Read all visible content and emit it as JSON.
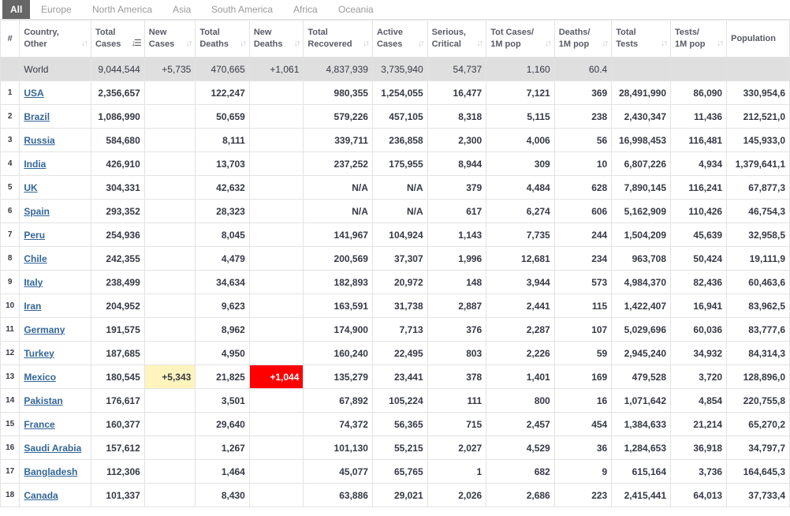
{
  "tabs": [
    "All",
    "Europe",
    "North America",
    "Asia",
    "South America",
    "Africa",
    "Oceania"
  ],
  "headers": {
    "index": "#",
    "country": "Country, Other",
    "total_cases": "Total Cases",
    "new_cases": "New Cases",
    "total_deaths": "Total Deaths",
    "new_deaths": "New Deaths",
    "total_recovered": "Total Recovered",
    "active_cases": "Active Cases",
    "serious": "Serious, Critical",
    "tot_cases_1m": "Tot Cases/ 1M pop",
    "deaths_1m": "Deaths/ 1M pop",
    "total_tests": "Total Tests",
    "tests_1m": "Tests/ 1M pop",
    "population": "Population"
  },
  "world": {
    "country": "World",
    "total_cases": "9,044,544",
    "new_cases": "+5,735",
    "total_deaths": "470,665",
    "new_deaths": "+1,061",
    "total_recovered": "4,837,939",
    "active_cases": "3,735,940",
    "serious": "54,737",
    "tot_cases_1m": "1,160",
    "deaths_1m": "60.4",
    "total_tests": "",
    "tests_1m": "",
    "population": ""
  },
  "rows": [
    {
      "idx": "1",
      "country": "USA",
      "total_cases": "2,356,657",
      "new_cases": "",
      "total_deaths": "122,247",
      "new_deaths": "",
      "total_recovered": "980,355",
      "active_cases": "1,254,055",
      "serious": "16,477",
      "tot_cases_1m": "7,121",
      "deaths_1m": "369",
      "total_tests": "28,491,990",
      "tests_1m": "86,090",
      "population": "330,954,6"
    },
    {
      "idx": "2",
      "country": "Brazil",
      "total_cases": "1,086,990",
      "new_cases": "",
      "total_deaths": "50,659",
      "new_deaths": "",
      "total_recovered": "579,226",
      "active_cases": "457,105",
      "serious": "8,318",
      "tot_cases_1m": "5,115",
      "deaths_1m": "238",
      "total_tests": "2,430,347",
      "tests_1m": "11,436",
      "population": "212,521,0"
    },
    {
      "idx": "3",
      "country": "Russia",
      "total_cases": "584,680",
      "new_cases": "",
      "total_deaths": "8,111",
      "new_deaths": "",
      "total_recovered": "339,711",
      "active_cases": "236,858",
      "serious": "2,300",
      "tot_cases_1m": "4,006",
      "deaths_1m": "56",
      "total_tests": "16,998,453",
      "tests_1m": "116,481",
      "population": "145,933,0"
    },
    {
      "idx": "4",
      "country": "India",
      "total_cases": "426,910",
      "new_cases": "",
      "total_deaths": "13,703",
      "new_deaths": "",
      "total_recovered": "237,252",
      "active_cases": "175,955",
      "serious": "8,944",
      "tot_cases_1m": "309",
      "deaths_1m": "10",
      "total_tests": "6,807,226",
      "tests_1m": "4,934",
      "population": "1,379,641,1"
    },
    {
      "idx": "5",
      "country": "UK",
      "total_cases": "304,331",
      "new_cases": "",
      "total_deaths": "42,632",
      "new_deaths": "",
      "total_recovered": "N/A",
      "active_cases": "N/A",
      "serious": "379",
      "tot_cases_1m": "4,484",
      "deaths_1m": "628",
      "total_tests": "7,890,145",
      "tests_1m": "116,241",
      "population": "67,877,3"
    },
    {
      "idx": "6",
      "country": "Spain",
      "total_cases": "293,352",
      "new_cases": "",
      "total_deaths": "28,323",
      "new_deaths": "",
      "total_recovered": "N/A",
      "active_cases": "N/A",
      "serious": "617",
      "tot_cases_1m": "6,274",
      "deaths_1m": "606",
      "total_tests": "5,162,909",
      "tests_1m": "110,426",
      "population": "46,754,3"
    },
    {
      "idx": "7",
      "country": "Peru",
      "total_cases": "254,936",
      "new_cases": "",
      "total_deaths": "8,045",
      "new_deaths": "",
      "total_recovered": "141,967",
      "active_cases": "104,924",
      "serious": "1,143",
      "tot_cases_1m": "7,735",
      "deaths_1m": "244",
      "total_tests": "1,504,209",
      "tests_1m": "45,639",
      "population": "32,958,5"
    },
    {
      "idx": "8",
      "country": "Chile",
      "total_cases": "242,355",
      "new_cases": "",
      "total_deaths": "4,479",
      "new_deaths": "",
      "total_recovered": "200,569",
      "active_cases": "37,307",
      "serious": "1,996",
      "tot_cases_1m": "12,681",
      "deaths_1m": "234",
      "total_tests": "963,708",
      "tests_1m": "50,424",
      "population": "19,111,9"
    },
    {
      "idx": "9",
      "country": "Italy",
      "total_cases": "238,499",
      "new_cases": "",
      "total_deaths": "34,634",
      "new_deaths": "",
      "total_recovered": "182,893",
      "active_cases": "20,972",
      "serious": "148",
      "tot_cases_1m": "3,944",
      "deaths_1m": "573",
      "total_tests": "4,984,370",
      "tests_1m": "82,436",
      "population": "60,463,6"
    },
    {
      "idx": "10",
      "country": "Iran",
      "total_cases": "204,952",
      "new_cases": "",
      "total_deaths": "9,623",
      "new_deaths": "",
      "total_recovered": "163,591",
      "active_cases": "31,738",
      "serious": "2,887",
      "tot_cases_1m": "2,441",
      "deaths_1m": "115",
      "total_tests": "1,422,407",
      "tests_1m": "16,941",
      "population": "83,962,5"
    },
    {
      "idx": "11",
      "country": "Germany",
      "total_cases": "191,575",
      "new_cases": "",
      "total_deaths": "8,962",
      "new_deaths": "",
      "total_recovered": "174,900",
      "active_cases": "7,713",
      "serious": "376",
      "tot_cases_1m": "2,287",
      "deaths_1m": "107",
      "total_tests": "5,029,696",
      "tests_1m": "60,036",
      "population": "83,777,6"
    },
    {
      "idx": "12",
      "country": "Turkey",
      "total_cases": "187,685",
      "new_cases": "",
      "total_deaths": "4,950",
      "new_deaths": "",
      "total_recovered": "160,240",
      "active_cases": "22,495",
      "serious": "803",
      "tot_cases_1m": "2,226",
      "deaths_1m": "59",
      "total_tests": "2,945,240",
      "tests_1m": "34,932",
      "population": "84,314,3"
    },
    {
      "idx": "13",
      "country": "Mexico",
      "total_cases": "180,545",
      "new_cases": "+5,343",
      "total_deaths": "21,825",
      "new_deaths": "+1,044",
      "total_recovered": "135,279",
      "active_cases": "23,441",
      "serious": "378",
      "tot_cases_1m": "1,401",
      "deaths_1m": "169",
      "total_tests": "479,528",
      "tests_1m": "3,720",
      "population": "128,896,0"
    },
    {
      "idx": "14",
      "country": "Pakistan",
      "total_cases": "176,617",
      "new_cases": "",
      "total_deaths": "3,501",
      "new_deaths": "",
      "total_recovered": "67,892",
      "active_cases": "105,224",
      "serious": "111",
      "tot_cases_1m": "800",
      "deaths_1m": "16",
      "total_tests": "1,071,642",
      "tests_1m": "4,854",
      "population": "220,755,8"
    },
    {
      "idx": "15",
      "country": "France",
      "total_cases": "160,377",
      "new_cases": "",
      "total_deaths": "29,640",
      "new_deaths": "",
      "total_recovered": "74,372",
      "active_cases": "56,365",
      "serious": "715",
      "tot_cases_1m": "2,457",
      "deaths_1m": "454",
      "total_tests": "1,384,633",
      "tests_1m": "21,214",
      "population": "65,270,2"
    },
    {
      "idx": "16",
      "country": "Saudi Arabia",
      "total_cases": "157,612",
      "new_cases": "",
      "total_deaths": "1,267",
      "new_deaths": "",
      "total_recovered": "101,130",
      "active_cases": "55,215",
      "serious": "2,027",
      "tot_cases_1m": "4,529",
      "deaths_1m": "36",
      "total_tests": "1,284,653",
      "tests_1m": "36,918",
      "population": "34,797,7"
    },
    {
      "idx": "17",
      "country": "Bangladesh",
      "total_cases": "112,306",
      "new_cases": "",
      "total_deaths": "1,464",
      "new_deaths": "",
      "total_recovered": "45,077",
      "active_cases": "65,765",
      "serious": "1",
      "tot_cases_1m": "682",
      "deaths_1m": "9",
      "total_tests": "615,164",
      "tests_1m": "3,736",
      "population": "164,645,3"
    },
    {
      "idx": "18",
      "country": "Canada",
      "total_cases": "101,337",
      "new_cases": "",
      "total_deaths": "8,430",
      "new_deaths": "",
      "total_recovered": "63,886",
      "active_cases": "29,021",
      "serious": "2,026",
      "tot_cases_1m": "2,686",
      "deaths_1m": "223",
      "total_tests": "2,415,441",
      "tests_1m": "64,013",
      "population": "37,733,4"
    }
  ],
  "colors": {
    "tab_active_bg": "#666666",
    "link": "#336699",
    "world_row_bg": "#dfdfdf",
    "new_cases_highlight": "#fff5bc",
    "new_deaths_highlight": "#ff0000"
  },
  "sort_icon": "sort-arrows-icon",
  "active_sort_column": "total_cases"
}
